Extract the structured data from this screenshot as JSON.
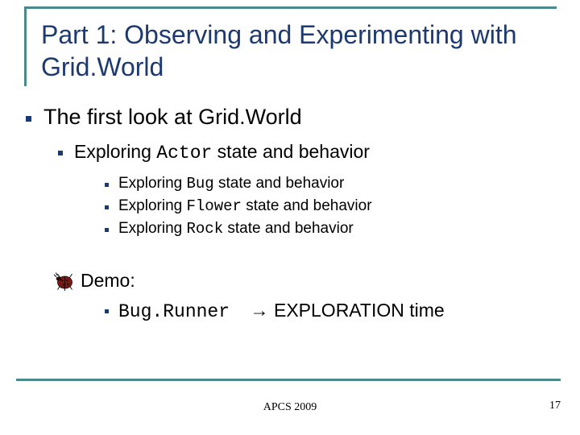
{
  "title": "Part 1: Observing and Experimenting with Grid.World",
  "l1": {
    "text": "The first look at Grid.World"
  },
  "l2a": {
    "pre": "Exploring ",
    "code": "Actor",
    "post": " state and behavior"
  },
  "l3a": {
    "pre": "Exploring ",
    "code": "Bug",
    "post": " state and behavior"
  },
  "l3b": {
    "pre": "Exploring ",
    "code": "Flower",
    "post": " state and behavior"
  },
  "l3c": {
    "pre": "Exploring ",
    "code": "Rock",
    "post": " state and behavior"
  },
  "demo": {
    "label": "Demo:"
  },
  "demo_sub": {
    "code": "Bug.Runner",
    "arrow": "→",
    "post": "  EXPLORATION time"
  },
  "footer": "APCS 2009",
  "page": "17",
  "icons": {
    "bug": "bug-icon"
  }
}
